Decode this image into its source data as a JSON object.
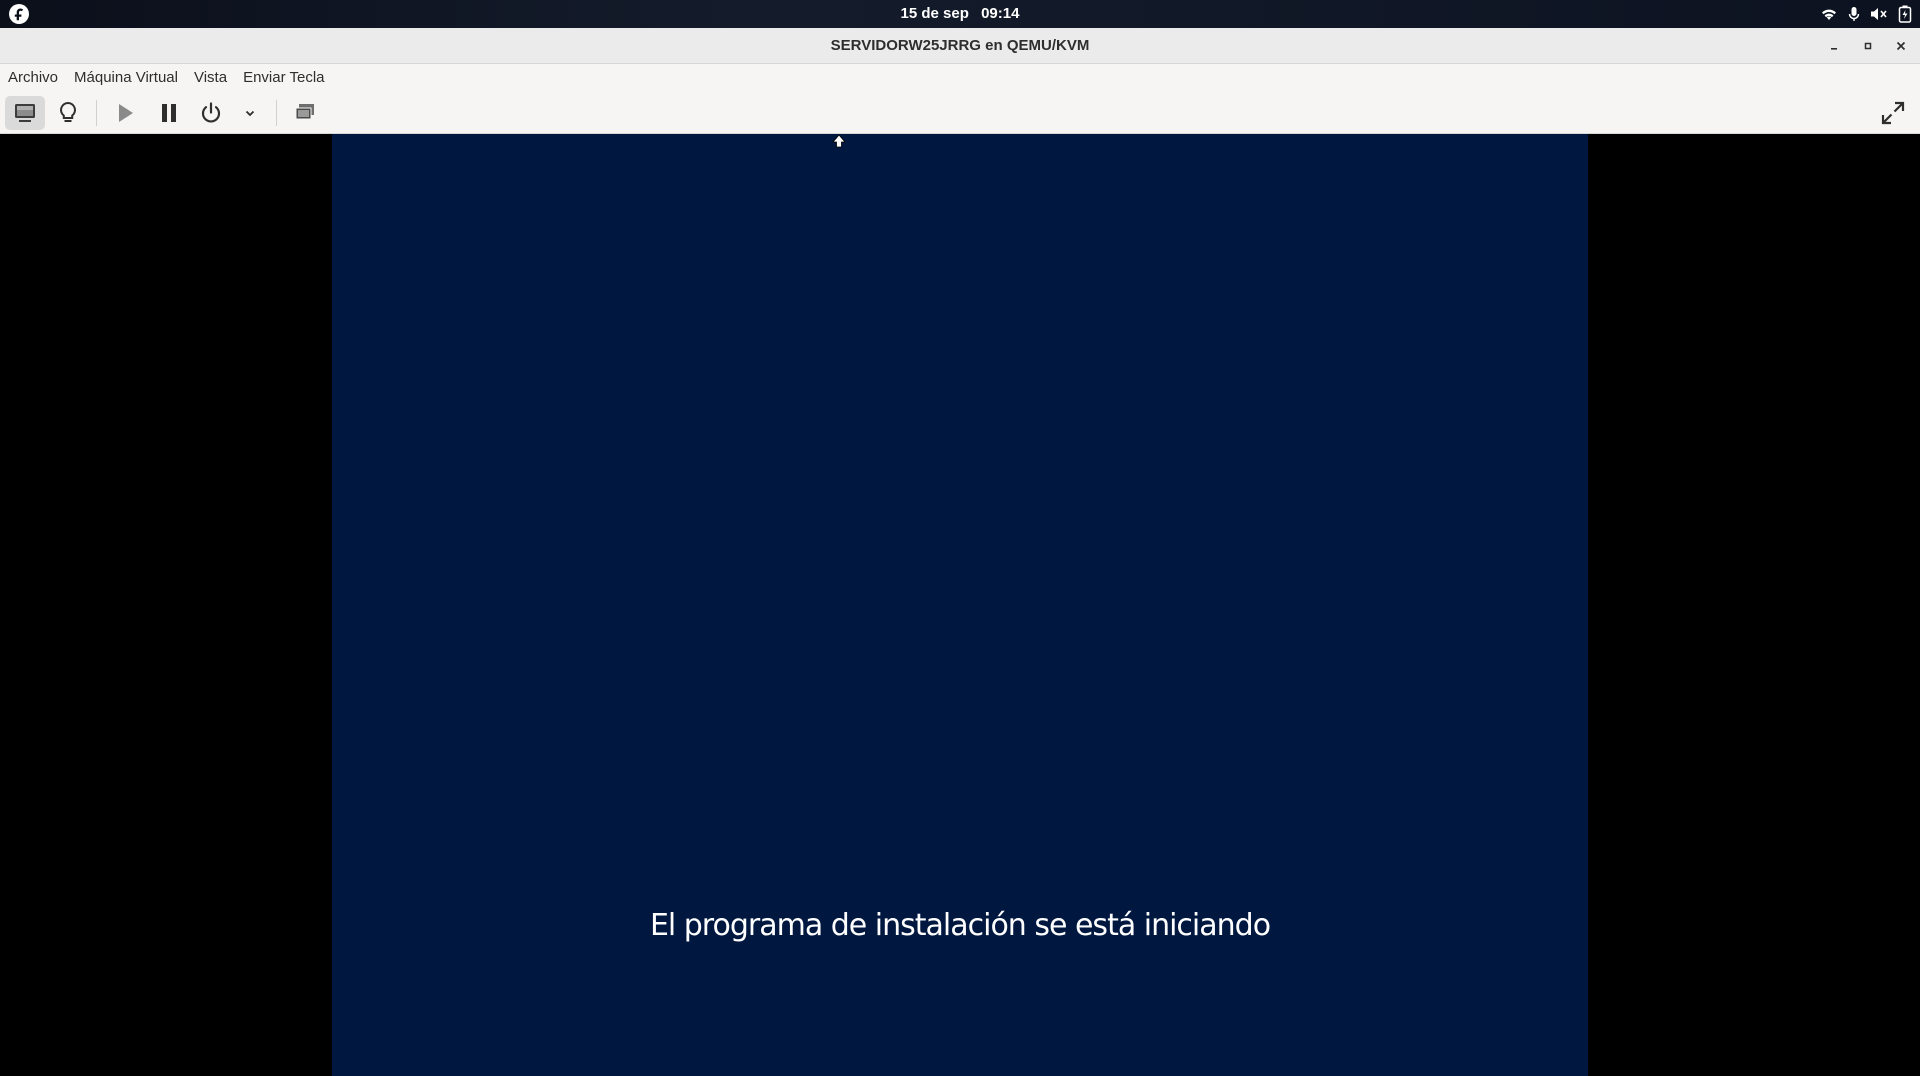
{
  "topbar": {
    "date": "15 de sep",
    "time": "09:14",
    "icons": [
      "fedora-logo-icon",
      "wifi-icon",
      "microphone-icon",
      "volume-muted-icon",
      "battery-charging-icon"
    ]
  },
  "window": {
    "title": "SERVIDORW25JRRG en QEMU/KVM",
    "controls": [
      "minimize-icon",
      "maximize-icon",
      "close-icon"
    ]
  },
  "menubar": {
    "items": [
      {
        "label": "Archivo"
      },
      {
        "label": "Máquina Virtual"
      },
      {
        "label": "Vista"
      },
      {
        "label": "Enviar Tecla"
      }
    ]
  },
  "toolbar": {
    "buttons": [
      "console-icon",
      "details-lightbulb-icon",
      "run-icon",
      "pause-icon",
      "power-icon",
      "dropdown-chevron-icon",
      "snapshots-icon",
      "fullscreen-icon"
    ],
    "active": "console-icon"
  },
  "vm": {
    "background_color": "#001840",
    "message": "El programa de instalación se está iniciando"
  }
}
